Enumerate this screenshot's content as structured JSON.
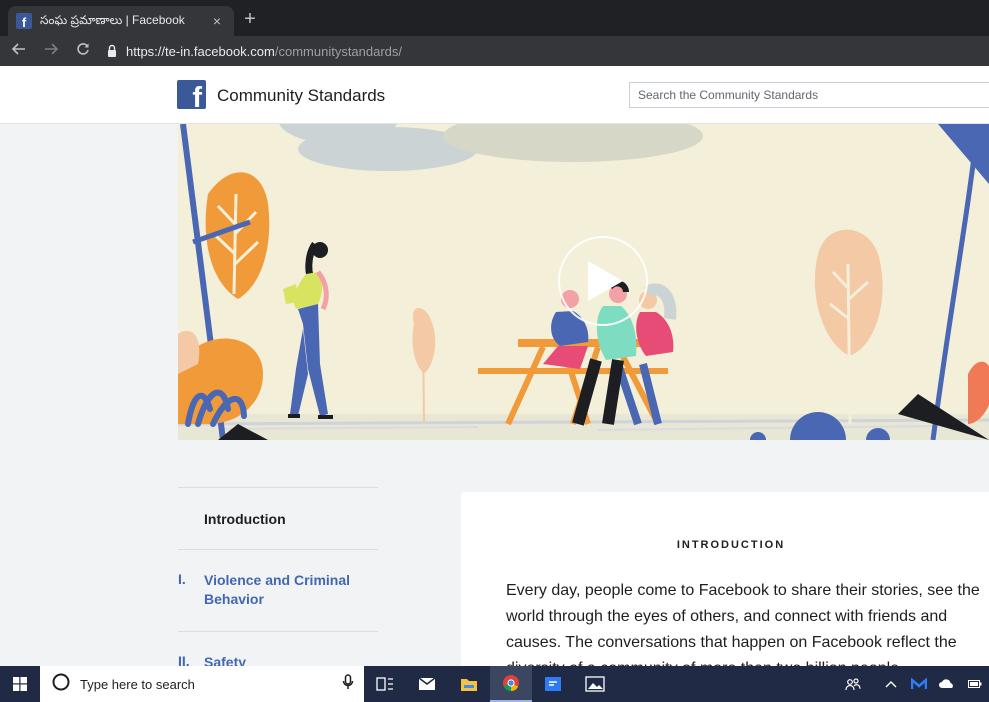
{
  "browser": {
    "tab_title": "సంఘ ప్రమాణాలు | Facebook",
    "tab_close": "×",
    "new_tab": "+",
    "url_host": "https://te-in.facebook.com",
    "url_path": "/communitystandards/"
  },
  "header": {
    "logo_letter": "f",
    "site_title": "Community Standards",
    "search_placeholder": "Search the Community Standards"
  },
  "nav": {
    "items": [
      {
        "number": "",
        "label": "Introduction"
      },
      {
        "number": "I.",
        "label": "Violence and Criminal Behavior"
      },
      {
        "number": "II.",
        "label": "Safety"
      }
    ]
  },
  "content": {
    "heading": "INTRODUCTION",
    "body": "Every day, people come to Facebook to share their stories, see the world through the eyes of others, and connect with friends and causes. The conversations that happen on Facebook reflect the diversity of a community of more than two billion people"
  },
  "taskbar": {
    "search_placeholder": "Type here to search"
  },
  "colors": {
    "fb_blue": "#3b5998",
    "link_blue": "#4267b2",
    "taskbar": "#202a45",
    "chrome_dark": "#202124"
  },
  "icons": [
    "facebook-logo",
    "lock-icon",
    "back-arrow-icon",
    "forward-arrow-icon",
    "reload-icon",
    "play-icon",
    "windows-start-icon",
    "cortana-circle-icon",
    "microphone-icon",
    "task-view-icon",
    "mail-icon",
    "file-explorer-icon",
    "chrome-icon",
    "messaging-icon",
    "photos-icon"
  ]
}
